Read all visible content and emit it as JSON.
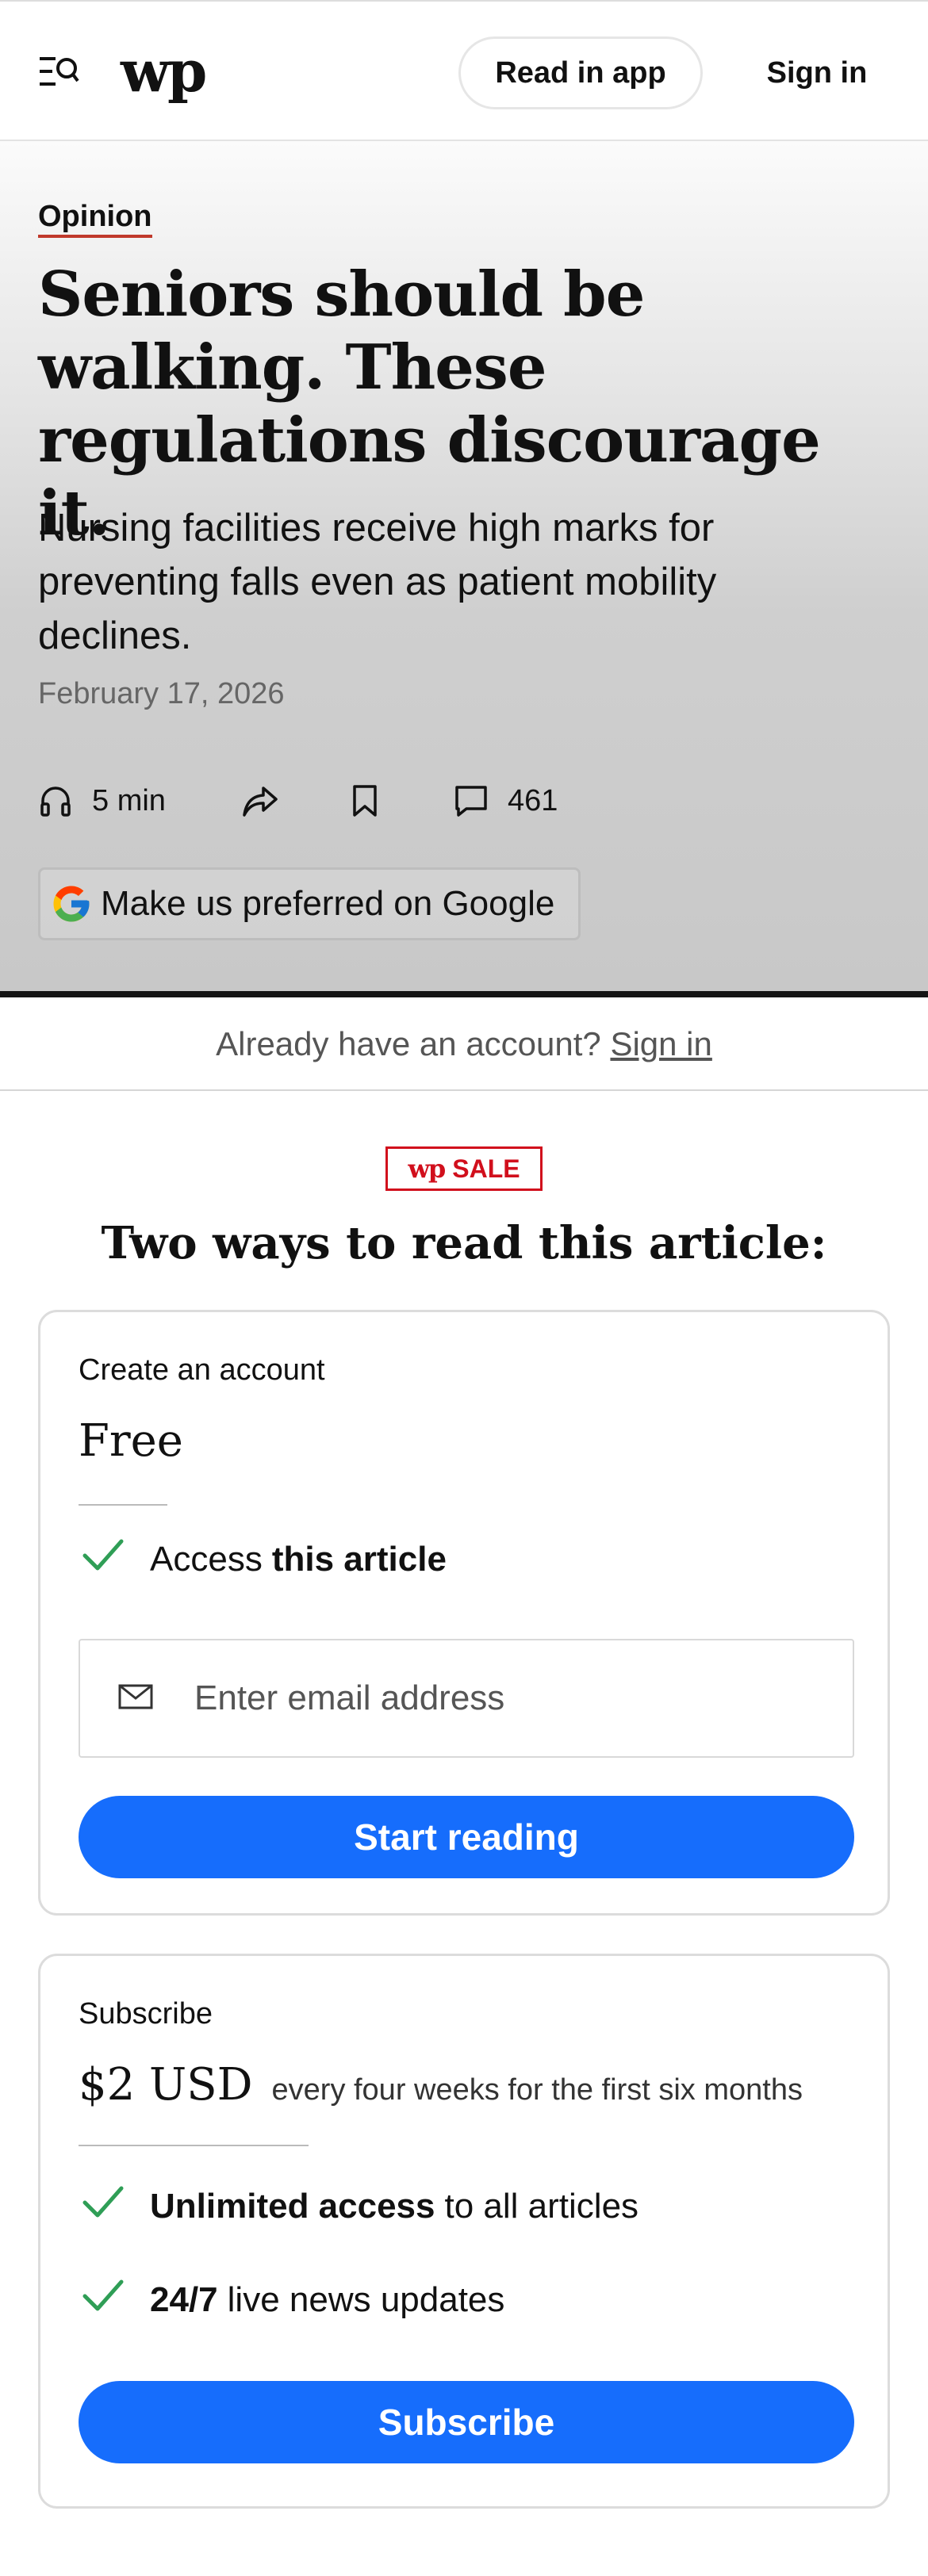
{
  "header": {
    "logo": "wp",
    "read_in_app": "Read in app",
    "sign_in": "Sign in"
  },
  "article": {
    "kicker": "Opinion",
    "headline": "Seniors should be walking. These regulations discourage it.",
    "dek": "Nursing facilities receive high marks for preventing falls even as patient mobility declines.",
    "date": "February 17, 2026",
    "listen_time": "5 min",
    "comment_count": "461",
    "google_pref": "Make us preferred on Google"
  },
  "account_bar": {
    "prompt": "Already have an account?",
    "link": "Sign in"
  },
  "offer": {
    "badge_logo": "wp",
    "badge_text": "SALE",
    "heading": "Two ways to read this article:",
    "free_card": {
      "label": "Create an account",
      "price": "Free",
      "benefit_prefix": "Access",
      "benefit_bold": "this article",
      "email_placeholder": "Enter email address",
      "button": "Start reading"
    },
    "sub_card": {
      "label": "Subscribe",
      "price": "$2 USD",
      "terms": "every four weeks for the first six months",
      "benefit1_bold": "Unlimited access",
      "benefit1_rest": "to all articles",
      "benefit2_bold": "24/7",
      "benefit2_rest": "live news updates",
      "button": "Subscribe"
    }
  },
  "colors": {
    "accent_blue": "#166dfc",
    "sale_red": "#d10f1c",
    "check_green": "#2f9e56",
    "kicker_underline": "#c0392b"
  }
}
